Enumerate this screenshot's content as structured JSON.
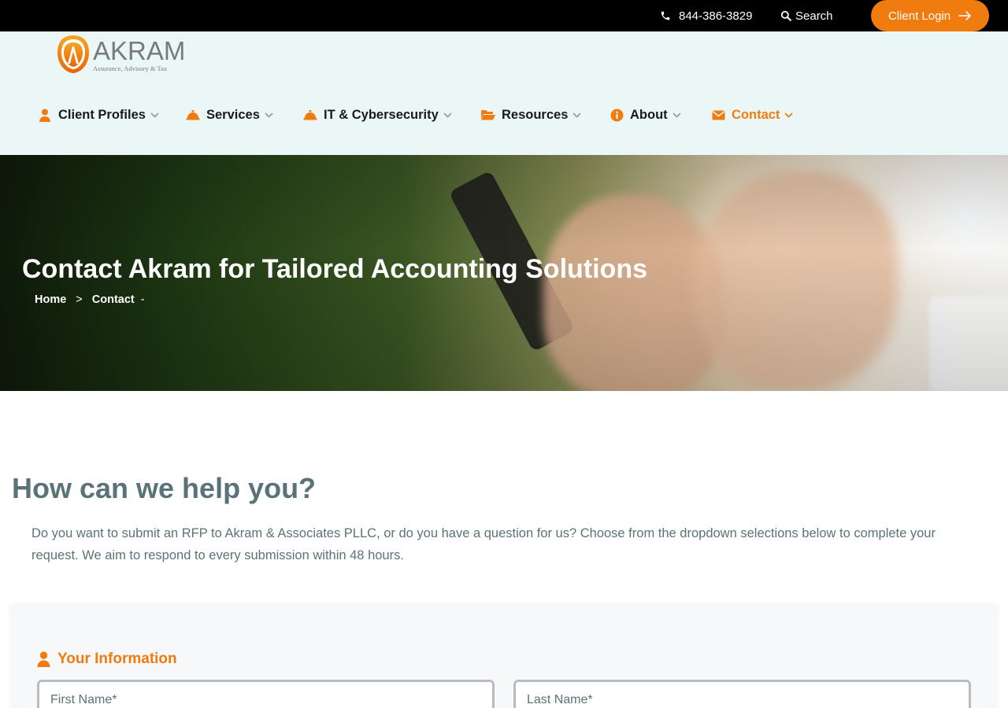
{
  "topbar": {
    "phone": "844-386-3829",
    "search_label": "Search",
    "login_label": "Client Login"
  },
  "logo": {
    "name": "AKRAM",
    "tagline": "Assurance, Advisory & Tax"
  },
  "nav": {
    "items": [
      {
        "label": "Client Profiles",
        "icon": "user-icon"
      },
      {
        "label": "Services",
        "icon": "bell-icon"
      },
      {
        "label": "IT & Cybersecurity",
        "icon": "bell-icon"
      },
      {
        "label": "Resources",
        "icon": "folder-icon"
      },
      {
        "label": "About",
        "icon": "info-icon"
      },
      {
        "label": "Contact",
        "icon": "envelope-icon",
        "active": true
      }
    ]
  },
  "hero": {
    "title": "Contact Akram for Tailored Accounting Solutions",
    "breadcrumb": [
      "Home",
      ">",
      "Contact",
      "-"
    ]
  },
  "content": {
    "heading": "How can we help you?",
    "intro": "Do you want to submit an RFP to Akram & Associates PLLC, or do you have a question for us? Choose from the dropdown selections below to complete your request. We aim to respond to every submission within 48 hours."
  },
  "form": {
    "section_title": "Your Information",
    "first_name_placeholder": "First Name*",
    "last_name_placeholder": "Last Name*"
  },
  "colors": {
    "accent": "#f07b0e",
    "text_muted": "#5a7378",
    "header_bg": "#ebf7f7"
  }
}
